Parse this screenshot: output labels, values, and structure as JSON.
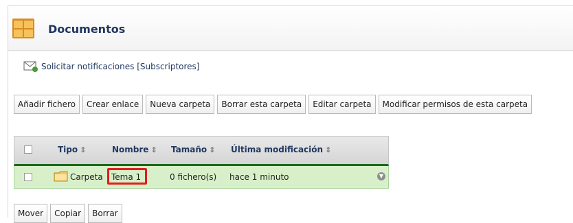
{
  "header": {
    "title": "Documentos",
    "icon": "folder-cabinet-icon"
  },
  "notifications": {
    "link_label": "Solicitar notificaciones [Subscriptores]",
    "icon": "envelope-subscribe-icon"
  },
  "toolbar": {
    "buttons": [
      "Añadir fichero",
      "Crear enlace",
      "Nueva carpeta",
      "Borrar esta carpeta",
      "Editar carpeta",
      "Modificar permisos de esta carpeta"
    ]
  },
  "table": {
    "columns": [
      "Tipo",
      "Nombre",
      "Tamaño",
      "Última modificación"
    ],
    "sort_glyph": "⇕",
    "rows": [
      {
        "type": "Carpeta",
        "name": "Tema 1",
        "size": "0 fichero(s)",
        "modified": "hace 1 minuto",
        "icon": "folder-icon",
        "action_icon": "chevron-down-icon"
      }
    ]
  },
  "actions": {
    "buttons": [
      "Mover",
      "Copiar",
      "Borrar"
    ]
  },
  "colors": {
    "title": "#1f3760",
    "row_bg": "#d8f0c9",
    "header_rule": "#1a6a1a",
    "highlight": "#e21b1b"
  }
}
